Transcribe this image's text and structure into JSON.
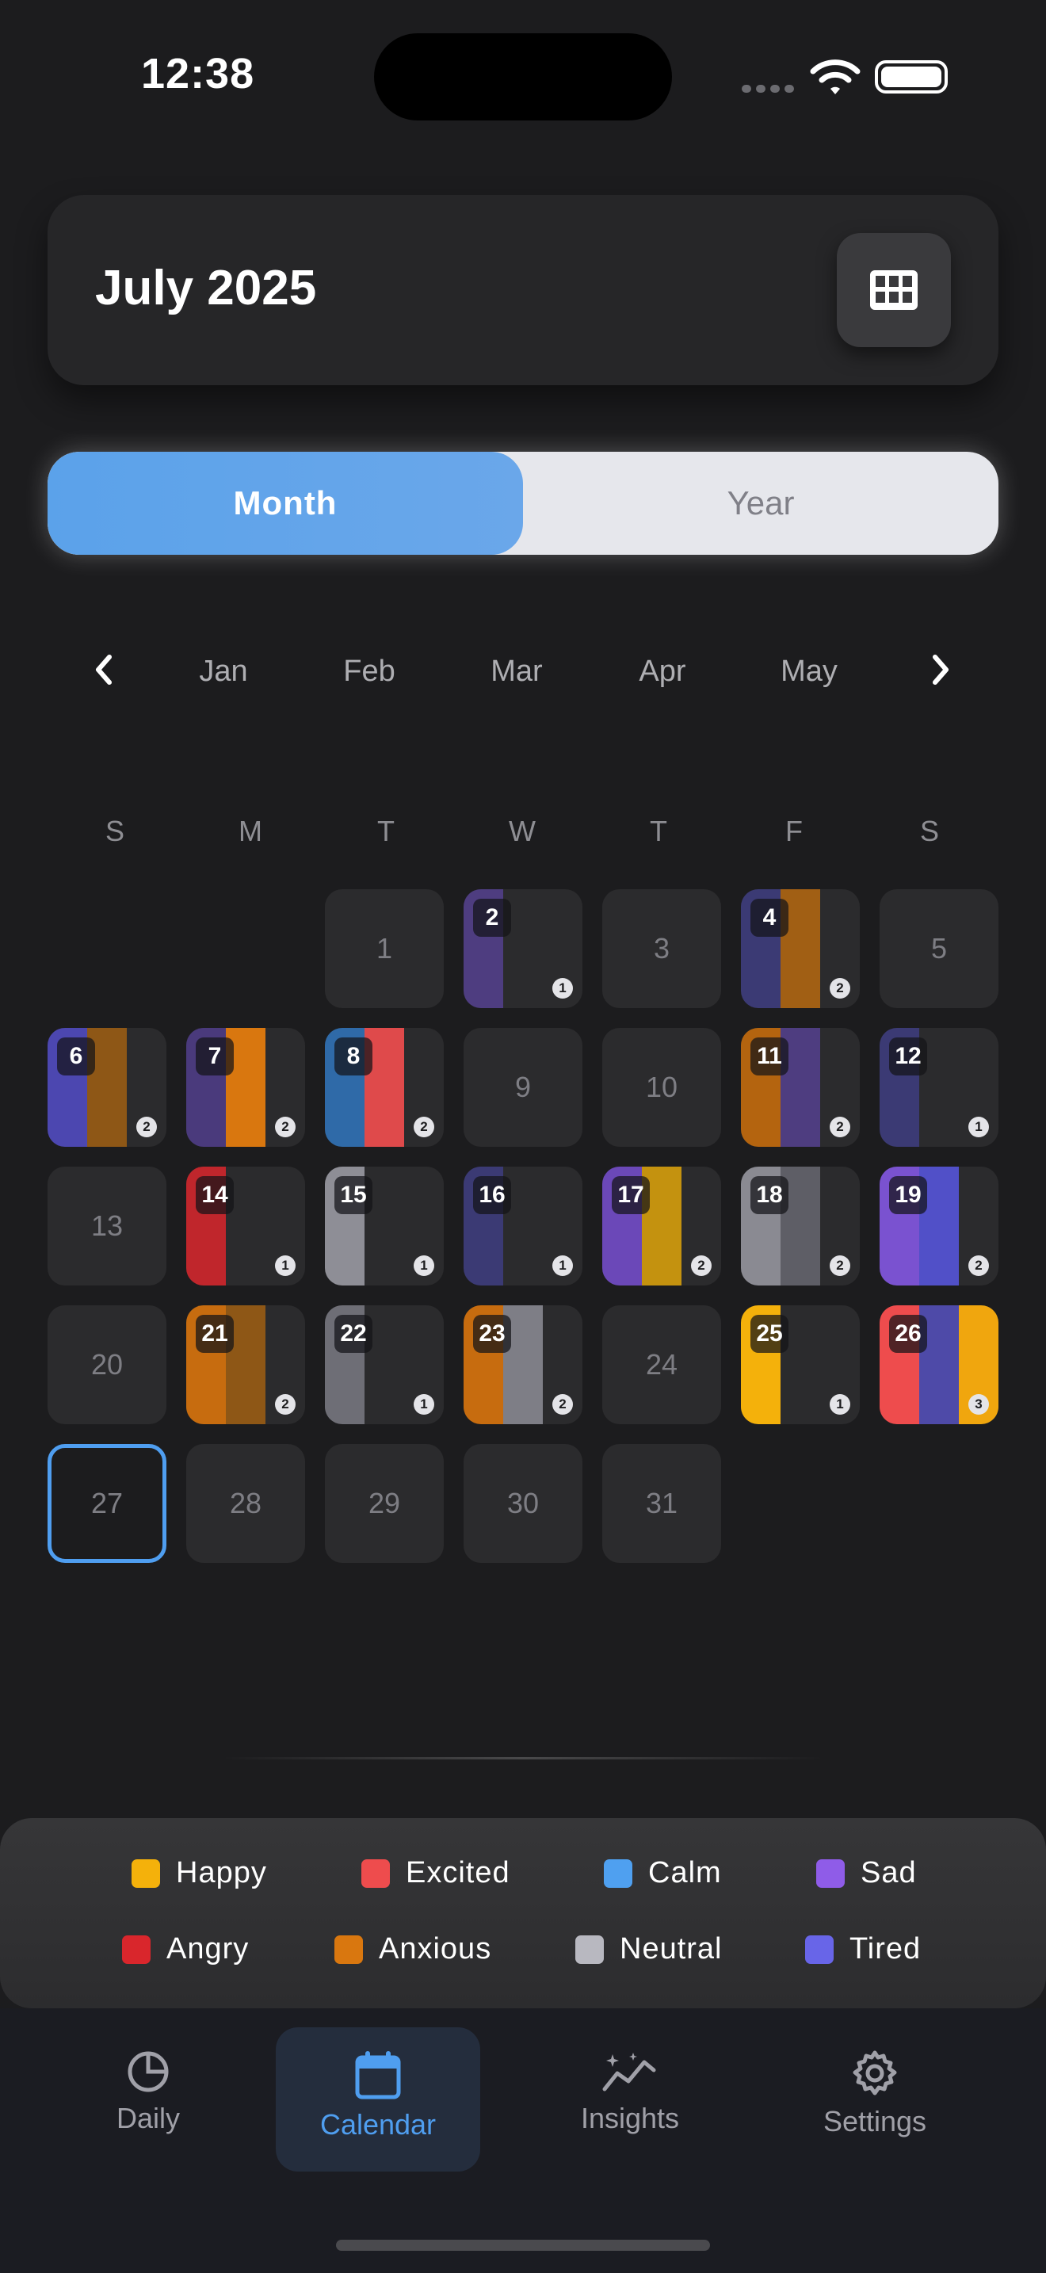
{
  "status": {
    "time": "12:38"
  },
  "header": {
    "title": "July 2025",
    "grid_icon": "grid-icon"
  },
  "view_toggle": {
    "month": "Month",
    "year": "Year",
    "active": "Month"
  },
  "month_strip": {
    "months": [
      "Jan",
      "Feb",
      "Mar",
      "Apr",
      "May"
    ]
  },
  "weekdays": [
    "S",
    "M",
    "T",
    "W",
    "T",
    "F",
    "S"
  ],
  "colors": {
    "happy": "#f4b10b",
    "excited": "#ee4c4d",
    "calm": "#4fa0f0",
    "sad": "#8f5ce8",
    "angry": "#d9262c",
    "anxious": "#d9770f",
    "neutral": "#b8b8c0",
    "tired": "#6865e8"
  },
  "days": [
    {
      "d": "1",
      "stripes": [],
      "count": ""
    },
    {
      "d": "2",
      "stripes": [
        "#4e3d80"
      ],
      "count": "1"
    },
    {
      "d": "3",
      "stripes": [],
      "count": ""
    },
    {
      "d": "4",
      "stripes": [
        "#3b3a74",
        "#a15f14"
      ],
      "count": "2"
    },
    {
      "d": "5",
      "stripes": [],
      "count": ""
    },
    {
      "d": "6",
      "stripes": [
        "#4c47b0",
        "#8e5716"
      ],
      "count": "2"
    },
    {
      "d": "7",
      "stripes": [
        "#4a3a7c",
        "#d9770f"
      ],
      "count": "2"
    },
    {
      "d": "8",
      "stripes": [
        "#2f6aa8",
        "#df4a4b"
      ],
      "count": "2"
    },
    {
      "d": "9",
      "stripes": [],
      "count": ""
    },
    {
      "d": "10",
      "stripes": [],
      "count": ""
    },
    {
      "d": "11",
      "stripes": [
        "#b4640f",
        "#4e3d80"
      ],
      "count": "2"
    },
    {
      "d": "12",
      "stripes": [
        "#3b3a74"
      ],
      "count": "1"
    },
    {
      "d": "13",
      "stripes": [],
      "count": ""
    },
    {
      "d": "14",
      "stripes": [
        "#c0262c"
      ],
      "count": "1"
    },
    {
      "d": "15",
      "stripes": [
        "#8e8e96"
      ],
      "count": "1"
    },
    {
      "d": "16",
      "stripes": [
        "#3b3a74"
      ],
      "count": "1"
    },
    {
      "d": "17",
      "stripes": [
        "#6b48b8",
        "#c4920f"
      ],
      "count": "2"
    },
    {
      "d": "18",
      "stripes": [
        "#8a8a92",
        "#5e5e66"
      ],
      "count": "2"
    },
    {
      "d": "19",
      "stripes": [
        "#7a52d0",
        "#5150c8"
      ],
      "count": "2"
    },
    {
      "d": "20",
      "stripes": [],
      "count": ""
    },
    {
      "d": "21",
      "stripes": [
        "#c76c0f",
        "#8e5716"
      ],
      "count": "2"
    },
    {
      "d": "22",
      "stripes": [
        "#6e6e76"
      ],
      "count": "1"
    },
    {
      "d": "23",
      "stripes": [
        "#c76c0f",
        "#7e7e86"
      ],
      "count": "2"
    },
    {
      "d": "24",
      "stripes": [],
      "count": ""
    },
    {
      "d": "25",
      "stripes": [
        "#f4b10b"
      ],
      "count": "1"
    },
    {
      "d": "26",
      "stripes": [
        "#ee4c4d",
        "#4e4aa8",
        "#f0a60e"
      ],
      "count": "3"
    },
    {
      "d": "27",
      "stripes": [],
      "count": "",
      "today": true
    },
    {
      "d": "28",
      "stripes": [],
      "count": ""
    },
    {
      "d": "29",
      "stripes": [],
      "count": ""
    },
    {
      "d": "30",
      "stripes": [],
      "count": ""
    },
    {
      "d": "31",
      "stripes": [],
      "count": ""
    }
  ],
  "legend": [
    {
      "label": "Happy",
      "color": "#f4b10b"
    },
    {
      "label": "Excited",
      "color": "#ee4c4d"
    },
    {
      "label": "Calm",
      "color": "#4fa0f0"
    },
    {
      "label": "Sad",
      "color": "#8f5ce8"
    },
    {
      "label": "Angry",
      "color": "#d9262c"
    },
    {
      "label": "Anxious",
      "color": "#d9770f"
    },
    {
      "label": "Neutral",
      "color": "#b8b8c0"
    },
    {
      "label": "Tired",
      "color": "#6865e8"
    }
  ],
  "tabs": [
    {
      "label": "Daily",
      "icon": "pie-chart-icon"
    },
    {
      "label": "Calendar",
      "icon": "calendar-icon",
      "active": true
    },
    {
      "label": "Insights",
      "icon": "sparkle-trend-icon"
    },
    {
      "label": "Settings",
      "icon": "gear-icon"
    }
  ]
}
